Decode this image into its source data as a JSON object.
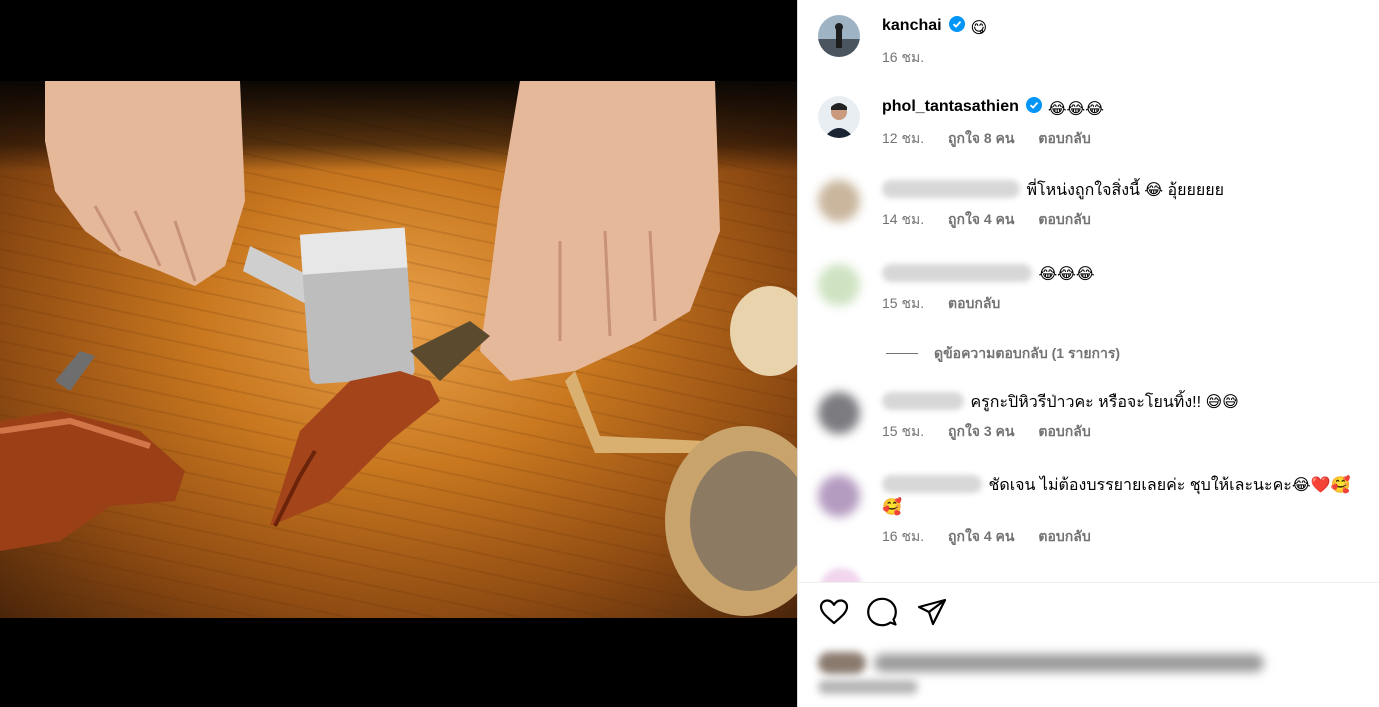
{
  "post_author": {
    "username": "kanchai",
    "caption_emoji": "😋",
    "time": "16 ชม."
  },
  "comments": [
    {
      "username": "phol_tantasathien",
      "verified": true,
      "text": "😂😂😂",
      "time": "12 ชม.",
      "likes": "ถูกใจ 8 คน",
      "reply": "ตอบกลับ"
    },
    {
      "username": "",
      "text": "พี่โหน่งถูกใจสิ่งนี้ 😂 อุ้ยยยยย",
      "time": "14 ชม.",
      "likes": "ถูกใจ 4 คน",
      "reply": "ตอบกลับ"
    },
    {
      "username": "",
      "text": "😂😂😂",
      "time": "15 ชม.",
      "reply": "ตอบกลับ"
    },
    {
      "username": "",
      "text": "ครูกะปิหิวรีป่าวคะ หรือจะโยนทิ้ง!! 😅😅",
      "time": "15 ชม.",
      "likes": "ถูกใจ 3 คน",
      "reply": "ตอบกลับ"
    },
    {
      "username": "",
      "text": "ชัดเจน ไม่ต้องบรรยายเลยค่ะ ชุบให้เละนะคะ😂❤️🥰",
      "text2": "🥰",
      "time": "16 ชม.",
      "likes": "ถูกใจ 4 คน",
      "reply": "ตอบกลับ"
    }
  ],
  "view_replies": "ดูข้อความตอบกลับ (1 รายการ)",
  "actions": {
    "like_icon": "heart-icon",
    "comment_icon": "comment-icon",
    "share_icon": "send-icon"
  },
  "colors": {
    "verified": "#0095f6",
    "meta": "#737373",
    "heart": "#e0245e"
  }
}
